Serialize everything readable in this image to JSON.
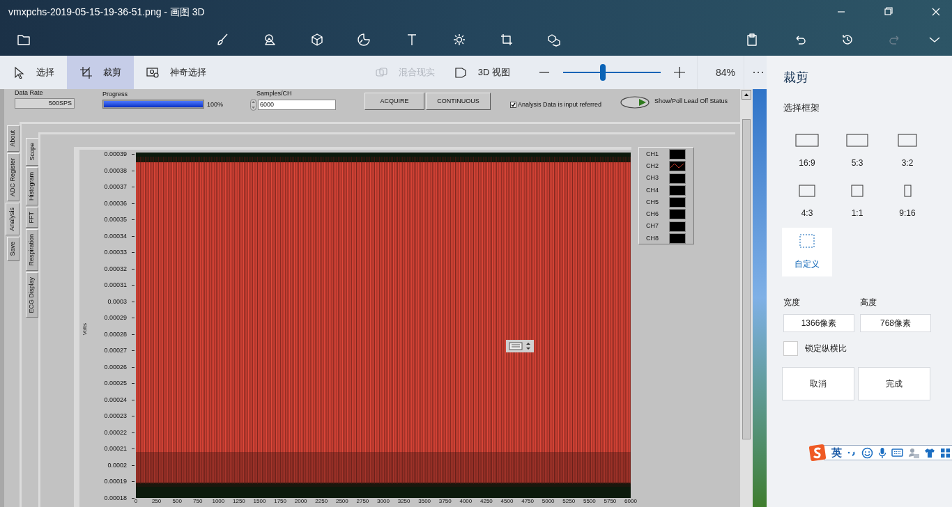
{
  "window": {
    "title": "vmxpchs-2019-05-15-19-36-51.png - 画图 3D"
  },
  "tools": [
    {
      "label": "选择",
      "selected": false
    },
    {
      "label": "裁剪",
      "selected": true
    },
    {
      "label": "神奇选择",
      "selected": false
    }
  ],
  "view_buttons": [
    {
      "label": "混合现实",
      "disabled": true
    },
    {
      "label": "3D 视图",
      "disabled": false
    }
  ],
  "zoom": {
    "level": 0.41,
    "reading": "84%"
  },
  "canvas_image": {
    "data_rate": {
      "label": "Data Rate",
      "value": "500SPS"
    },
    "progress": {
      "label": "Progress",
      "level": 1,
      "reading": "100%"
    },
    "samples": {
      "label": "Samples/CH",
      "value": "6000"
    },
    "buttons": [
      "ACQUIRE",
      "CONTINUOUS"
    ],
    "input_referred": {
      "label": "Analysis Data is input referred",
      "checked": true
    },
    "lead_off": {
      "label": "Show/Poll Lead Off Status",
      "on": true
    },
    "outer_tabs": [
      {
        "label": "About",
        "selected": false
      },
      {
        "label": "ADC Register",
        "selected": false
      },
      {
        "label": "Analysis",
        "selected": true
      },
      {
        "label": "Save",
        "selected": false
      }
    ],
    "inner_tabs": [
      {
        "label": "Scope",
        "selected": true
      },
      {
        "label": "Histogram",
        "selected": false
      },
      {
        "label": "FFT",
        "selected": false
      },
      {
        "label": "Respiration",
        "selected": false
      },
      {
        "label": "ECG Display",
        "selected": false
      }
    ],
    "graph": {
      "ylabel": "Volts",
      "y_ticks": [
        "0.00039",
        "0.00038",
        "0.00037",
        "0.00036",
        "0.00035",
        "0.00034",
        "0.00033",
        "0.00032",
        "0.00031",
        "0.0003",
        "0.00029",
        "0.00028",
        "0.00027",
        "0.00026",
        "0.00025",
        "0.00024",
        "0.00023",
        "0.00022",
        "0.00021",
        "0.0002",
        "0.00019",
        "0.00018"
      ],
      "x_ticks": [
        "0",
        "250",
        "500",
        "750",
        "1000",
        "1250",
        "1500",
        "1750",
        "2000",
        "2250",
        "2500",
        "2750",
        "3000",
        "3250",
        "3500",
        "3750",
        "4000",
        "4250",
        "4500",
        "4750",
        "5000",
        "5250",
        "5500",
        "5750",
        "6000"
      ]
    },
    "legend": [
      {
        "label": "CH1",
        "active": false
      },
      {
        "label": "CH2",
        "active": true
      },
      {
        "label": "CH3",
        "active": false
      },
      {
        "label": "CH4",
        "active": false
      },
      {
        "label": "CH5",
        "active": false
      },
      {
        "label": "CH6",
        "active": false
      },
      {
        "label": "CH7",
        "active": false
      },
      {
        "label": "CH8",
        "active": false
      }
    ]
  },
  "crop_panel": {
    "title": "裁剪",
    "frame_heading": "选择框架",
    "frames": [
      {
        "label": "16:9",
        "kind": "preset",
        "selected": false
      },
      {
        "label": "5:3",
        "kind": "preset",
        "selected": false
      },
      {
        "label": "3:2",
        "kind": "preset",
        "selected": false
      },
      {
        "label": "4:3",
        "kind": "preset",
        "selected": false
      },
      {
        "label": "1:1",
        "kind": "preset",
        "selected": false
      },
      {
        "label": "9:16",
        "kind": "preset",
        "selected": false
      },
      {
        "label": "自定义",
        "kind": "custom",
        "selected": true
      }
    ],
    "width": {
      "label": "宽度",
      "value": "1366像素"
    },
    "height": {
      "label": "高度",
      "value": "768像素"
    },
    "lock_ratio": {
      "label": "锁定纵横比",
      "checked": false
    },
    "buttons": [
      "取消",
      "完成"
    ]
  },
  "ime_bar": {
    "mode": "英"
  }
}
